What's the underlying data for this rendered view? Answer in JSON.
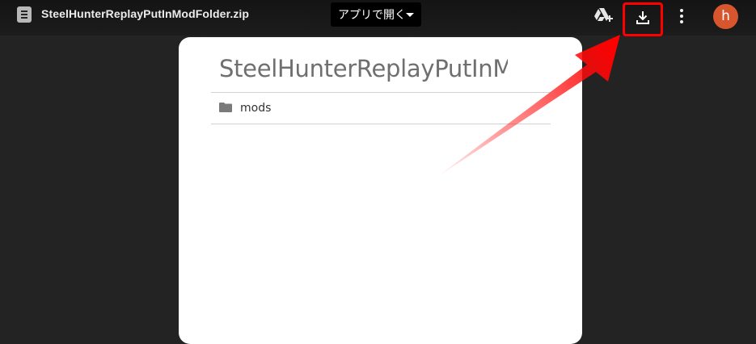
{
  "header": {
    "file_name": "SteelHunterReplayPutInModFolder.zip",
    "open_with_label": "アプリで開く",
    "icons": [
      "file-icon",
      "add-to-drive-icon",
      "download-icon",
      "more-vert-icon"
    ],
    "avatar_initial": "h",
    "avatar_color": "#d8562e",
    "highlight_color": "#ff0000"
  },
  "viewer": {
    "archive_title": "SteelHunterReplayPutInMod",
    "entries": [
      {
        "name": "mods",
        "icon": "folder-icon"
      }
    ]
  }
}
